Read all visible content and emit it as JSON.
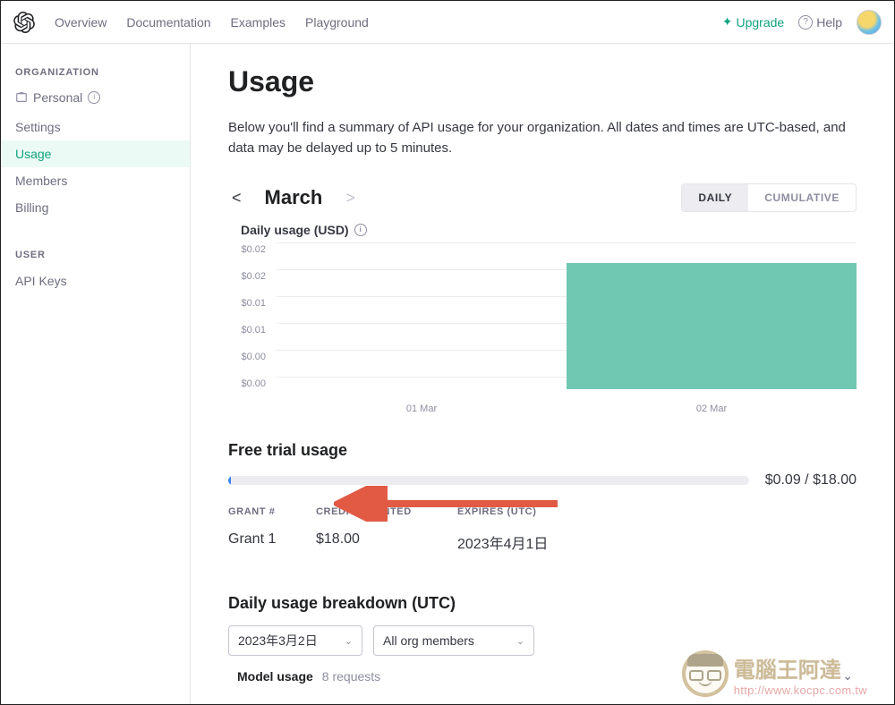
{
  "header": {
    "nav": [
      "Overview",
      "Documentation",
      "Examples",
      "Playground"
    ],
    "upgrade": "Upgrade",
    "help": "Help"
  },
  "sidebar": {
    "org_heading": "ORGANIZATION",
    "personal": "Personal",
    "items": [
      {
        "label": "Settings",
        "active": false
      },
      {
        "label": "Usage",
        "active": true
      },
      {
        "label": "Members",
        "active": false
      },
      {
        "label": "Billing",
        "active": false
      }
    ],
    "user_heading": "USER",
    "user_items": [
      {
        "label": "API Keys"
      }
    ]
  },
  "page": {
    "title": "Usage",
    "desc": "Below you'll find a summary of API usage for your organization. All dates and times are UTC-based, and data may be delayed up to 5 minutes.",
    "month": "March",
    "toggle": {
      "daily": "DAILY",
      "cumulative": "CUMULATIVE"
    },
    "chart_title": "Daily usage (USD)"
  },
  "chart_data": {
    "type": "bar",
    "title": "Daily usage (USD)",
    "xlabel": "",
    "ylabel": "",
    "ylim": [
      0,
      0.025
    ],
    "y_ticks": [
      "$0.02",
      "$0.02",
      "$0.01",
      "$0.01",
      "$0.00",
      "$0.00"
    ],
    "categories": [
      "01 Mar",
      "02 Mar"
    ],
    "values": [
      0,
      0.022
    ]
  },
  "free_trial": {
    "title": "Free trial usage",
    "used_label": "$0.09 / $18.00",
    "used": 0.09,
    "total": 18.0,
    "columns": [
      "GRANT #",
      "CREDIT GRANTED",
      "EXPIRES (UTC)"
    ],
    "rows": [
      {
        "grant": "Grant 1",
        "credit": "$18.00",
        "expires": "2023年4月1日"
      }
    ]
  },
  "breakdown": {
    "title": "Daily usage breakdown (UTC)",
    "date_select": "2023年3月2日",
    "org_select": "All org members",
    "model_usage_label": "Model usage",
    "model_usage_count": "8 requests"
  },
  "watermark": {
    "cn": "電腦王阿達",
    "url": "http://www.kocpc.com.tw"
  }
}
